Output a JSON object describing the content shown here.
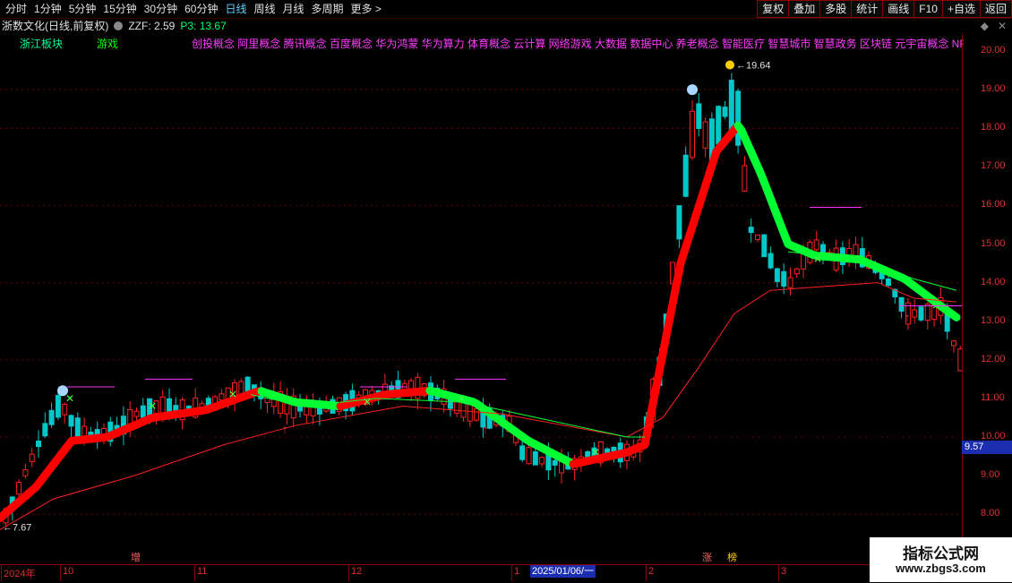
{
  "toolbar": {
    "timeframes": [
      "分时",
      "1分钟",
      "5分钟",
      "15分钟",
      "30分钟",
      "60分钟",
      "日线",
      "周线",
      "月线",
      "多周期",
      "更多 >"
    ],
    "active_timeframe": "日线",
    "buttons": [
      "复权",
      "叠加",
      "多股",
      "统计",
      "画线",
      "F10",
      "+自选",
      "返回"
    ],
    "right_icons": [
      "◆",
      "✕"
    ]
  },
  "info": {
    "stock_name": "浙数文化(日线,前复权)",
    "indicator": "ZZF: 2.59",
    "p3": "P3: 13.67"
  },
  "sector": {
    "board": "浙江板块",
    "industry": "游戏"
  },
  "concepts": "创投概念 阿里概念 腾讯概念 百度概念 华为鸿蒙 华为算力 体育概念 云计算 网络游戏 大数据 数据中心 养老概念 智能医疗 智慧城市 智慧政务 区块链 元宇宙概念 NFT",
  "price_axis": {
    "ticks": [
      "20.00",
      "19.00",
      "18.00",
      "17.00",
      "16.00",
      "15.00",
      "14.00",
      "13.00",
      "12.00",
      "11.00",
      "10.00",
      "9.00",
      "8.00"
    ],
    "current_price": "9.57"
  },
  "annotations": {
    "high": "19.64",
    "low": "7.67",
    "marker_zeng": "增",
    "marker_zhang": "涨",
    "marker_bang": "榜"
  },
  "date_bar": {
    "labels": [
      "2024年",
      "10",
      "11",
      "12",
      "1",
      "2",
      "3"
    ],
    "selected_date": "2025/01/06/一"
  },
  "watermark": {
    "title": "指标公式网",
    "url": "www.zbgs3.com"
  },
  "colors": {
    "up": "#ff2020",
    "down": "#00c8c8",
    "ribbon_up": "#ff0000",
    "ribbon_down": "#00ff33",
    "ma": "#ff2020",
    "ma_green": "#00ff33"
  }
}
